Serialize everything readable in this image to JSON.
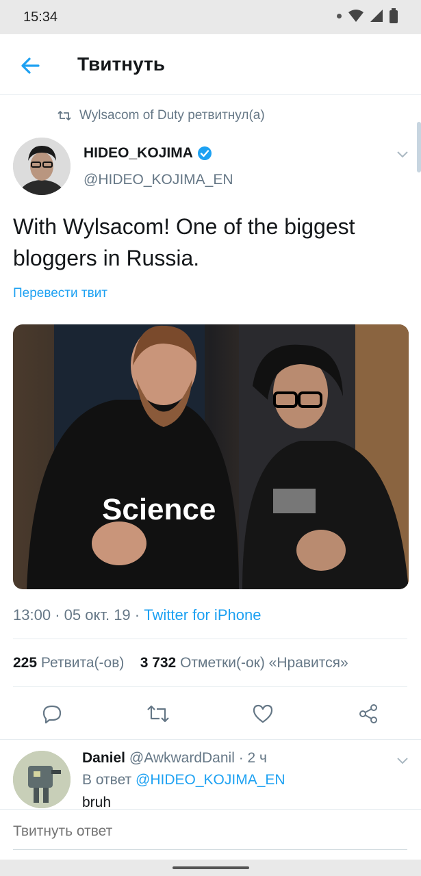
{
  "status_bar": {
    "time": "15:34"
  },
  "header": {
    "title": "Твитнуть",
    "back_icon": "arrow-left-icon"
  },
  "retweet_context": {
    "text": "Wylsacom of Duty ретвитнул(а)"
  },
  "tweet": {
    "author_name": "HIDEO_KOJIMA",
    "author_handle": "@HIDEO_KOJIMA_EN",
    "verified": true,
    "text": "With Wylsacom! One of the biggest bloggers in Russia.",
    "translate_label": "Перевести твит",
    "time": "13:00",
    "date": "05 окт. 19",
    "source": "Twitter for iPhone",
    "retweet_count": "225",
    "retweet_label": "Ретвита(-ов)",
    "like_count": "3 732",
    "like_label": "Отметки(-ок) «Нравится»"
  },
  "reply": {
    "name": "Daniel",
    "handle": "@AwkwardDanil",
    "time": "2 ч",
    "in_reply_prefix": "В ответ",
    "in_reply_handle": "@HIDEO_KOJIMA_EN",
    "text": "bruh"
  },
  "compose": {
    "placeholder": "Твитнуть ответ"
  },
  "colors": {
    "accent": "#1da1f2",
    "secondary_text": "#657786",
    "divider": "#e6ecf0"
  }
}
